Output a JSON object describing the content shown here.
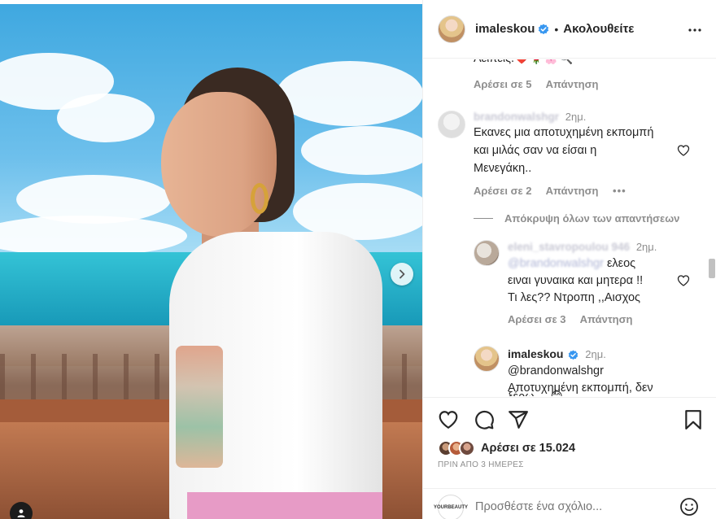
{
  "post": {
    "username": "imaleskou",
    "dot": "•",
    "follow_label": "Ακολουθείτε"
  },
  "comments": {
    "top_partial": {
      "text": "Λείπεις.❤️🌹🌸🔍",
      "likes": "Αρέσει σε 5",
      "reply": "Απάντηση"
    },
    "comment1": {
      "user": "brandonwalshgr",
      "time": "2ημ.",
      "lines": [
        "Εκανες μια αποτυχημένη εκπομπή",
        "και μιλάς σαν να είσαι η",
        "Μενεγάκη.."
      ],
      "likes": "Αρέσει σε 2",
      "reply": "Απάντηση",
      "more": "•••"
    },
    "hide_replies": "Απόκρυψη όλων των απαντήσεων",
    "reply1": {
      "user": "eleni_stavropoulou 946",
      "time": "2ημ.",
      "mention": "@brandonwalshgr",
      "line1_rest": "ελεος",
      "line2": "ειναι γυναικα και μητερα !!",
      "line3": "Τι λες?? Ντροπη ,,Αισχος",
      "likes": "Αρέσει σε 3",
      "reply": "Απάντηση"
    },
    "reply2": {
      "user": "imaleskou",
      "time": "2ημ.",
      "mention": "@brandonwalshgr",
      "line": "Αποτυχημένη εκπομπή, δεν",
      "partial": "ξέρω ... 😊"
    }
  },
  "actions": {
    "likes_text": "Αρέσει σε 15.024",
    "time_ago": "ΠΡΙΝ ΑΠΟ 3 ΗΜΕΡΕΣ"
  },
  "add_comment": {
    "avatar_text": "YOURBEAUTY",
    "placeholder": "Προσθέστε ένα σχόλιο..."
  },
  "colors": {
    "verified": "#3897f0",
    "meta_gray": "#8e8e8e",
    "text": "#262626"
  },
  "icons": [
    "chevron-right-icon",
    "person-tag-icon",
    "verified-icon",
    "more-icon",
    "heart-icon",
    "comment-icon",
    "share-icon",
    "bookmark-icon",
    "emoji-icon"
  ]
}
